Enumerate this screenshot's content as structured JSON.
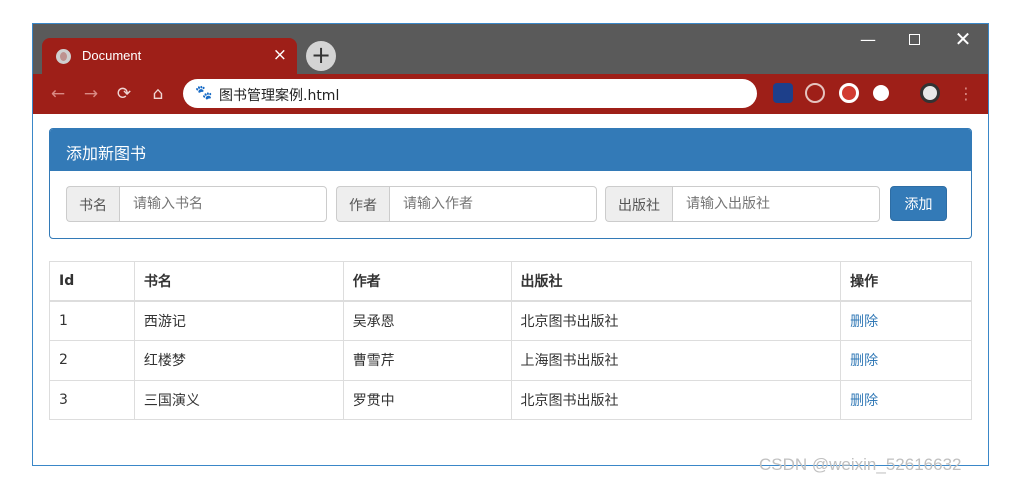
{
  "browser": {
    "tab_title": "Document",
    "tab_close": "×",
    "new_tab": "+",
    "url": "图书管理案例.html",
    "controls": {
      "minimize": "—",
      "close": "✕"
    },
    "nav": {
      "back": "←",
      "forward": "→",
      "reload": "⟳",
      "home": "⌂"
    }
  },
  "panel": {
    "title": "添加新图书",
    "fields": [
      {
        "label": "书名",
        "placeholder": "请输入书名"
      },
      {
        "label": "作者",
        "placeholder": "请输入作者"
      },
      {
        "label": "出版社",
        "placeholder": "请输入出版社"
      }
    ],
    "add_button": "添加"
  },
  "table": {
    "headers": [
      "Id",
      "书名",
      "作者",
      "出版社",
      "操作"
    ],
    "rows": [
      {
        "id": "1",
        "name": "西游记",
        "author": "吴承恩",
        "publisher": "北京图书出版社",
        "action": "删除"
      },
      {
        "id": "2",
        "name": "红楼梦",
        "author": "曹雪芹",
        "publisher": "上海图书出版社",
        "action": "删除"
      },
      {
        "id": "3",
        "name": "三国演义",
        "author": "罗贯中",
        "publisher": "北京图书出版社",
        "action": "删除"
      }
    ]
  },
  "watermark": "CSDN @weixin_52616632",
  "colors": {
    "primary": "#337ab7",
    "chrome_red": "#9e1f18",
    "titlebar": "#5a5a5a"
  }
}
